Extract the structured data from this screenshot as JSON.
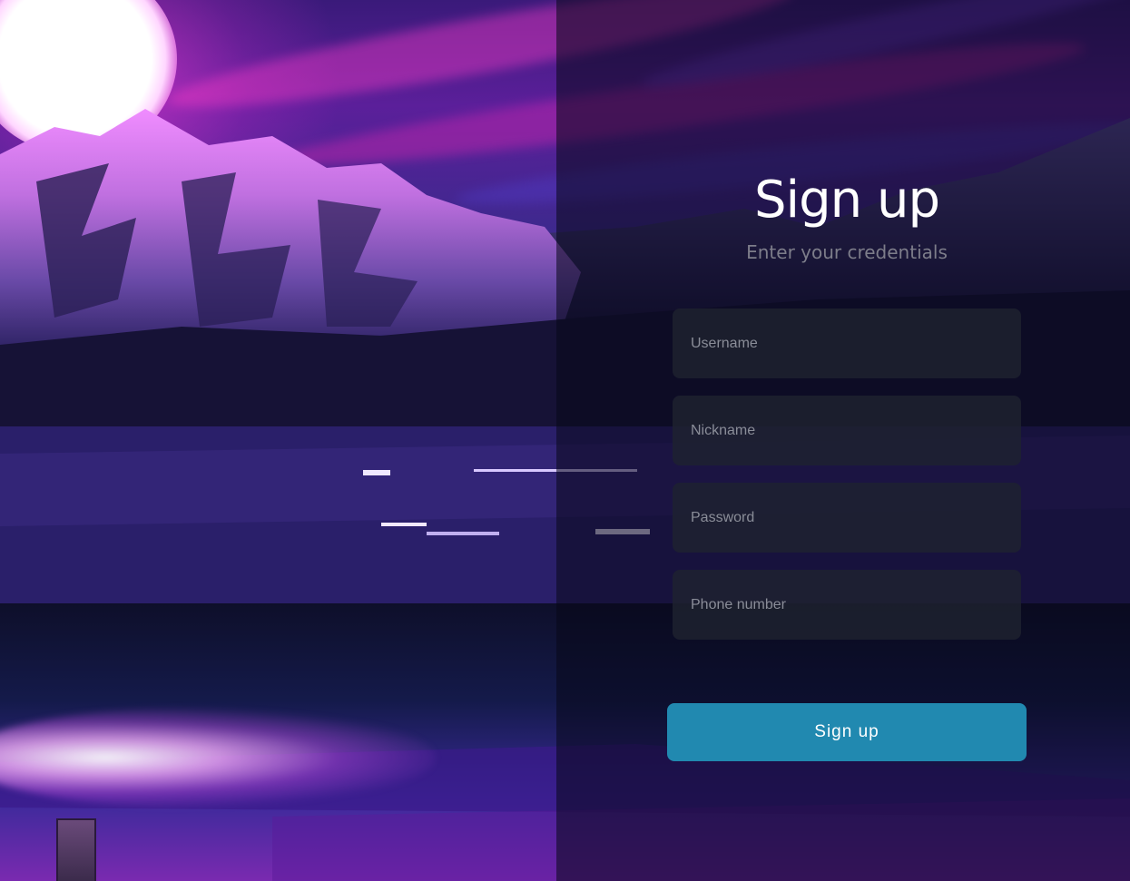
{
  "form": {
    "title": "Sign up",
    "subtitle": "Enter your credentials",
    "fields": [
      {
        "placeholder": "Username",
        "value": ""
      },
      {
        "placeholder": "Nickname",
        "value": ""
      },
      {
        "placeholder": "Password",
        "value": ""
      },
      {
        "placeholder": "Phone number",
        "value": ""
      }
    ],
    "submit_label": "Sign up"
  },
  "colors": {
    "button": "#2189b0",
    "field_background": "#1e2230",
    "subtitle": "#7d7d8a"
  }
}
